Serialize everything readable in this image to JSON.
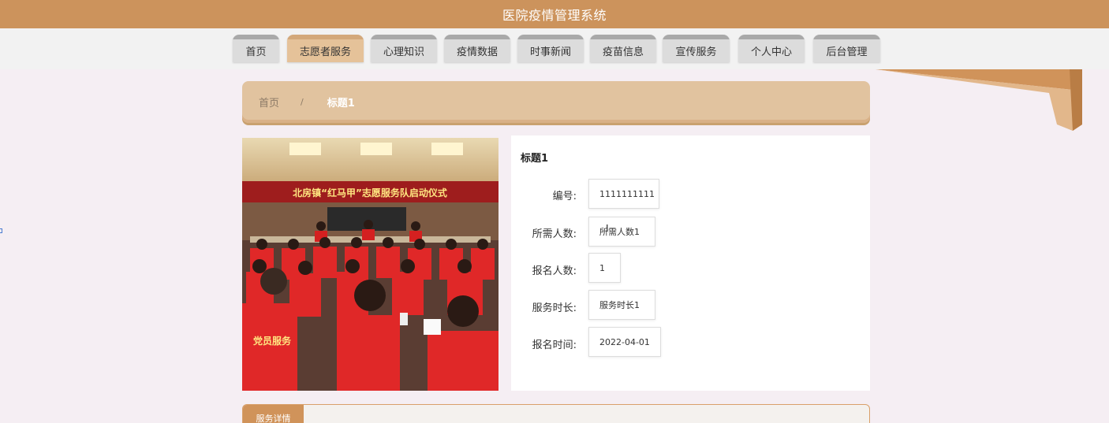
{
  "header": {
    "title": "医院疫情管理系统"
  },
  "nav": {
    "items": [
      {
        "label": "首页",
        "active": false
      },
      {
        "label": "志愿者服务",
        "active": true
      },
      {
        "label": "心理知识",
        "active": false
      },
      {
        "label": "疫情数据",
        "active": false
      },
      {
        "label": "时事新闻",
        "active": false
      },
      {
        "label": "疫苗信息",
        "active": false
      },
      {
        "label": "宣传服务",
        "active": false
      },
      {
        "label": "个人中心",
        "active": false
      },
      {
        "label": "后台管理",
        "active": false
      }
    ]
  },
  "breadcrumb": {
    "home": "首页",
    "separator": "/",
    "current": "标题1"
  },
  "photo": {
    "banner_text": "北房镇“红马甲”志愿服务队启动仪式",
    "vest_text": "党员服务"
  },
  "detail": {
    "title": "标题1",
    "fields": [
      {
        "label": "编号:",
        "value": "1111111111"
      },
      {
        "label": "所需人数:",
        "value": "所需人数1"
      },
      {
        "label": "报名人数:",
        "value": "1"
      },
      {
        "label": "服务时长:",
        "value": "服务时长1"
      },
      {
        "label": "报名时间:",
        "value": "2022-04-01"
      }
    ]
  },
  "service_detail": {
    "tab_label": "服务详情"
  },
  "colors": {
    "header": "#cc935c",
    "nav_active": "#e5c299",
    "nav_inactive": "#dcdcdc",
    "breadcrumb": "#e1c39f",
    "page_background": "#f5eef3"
  }
}
